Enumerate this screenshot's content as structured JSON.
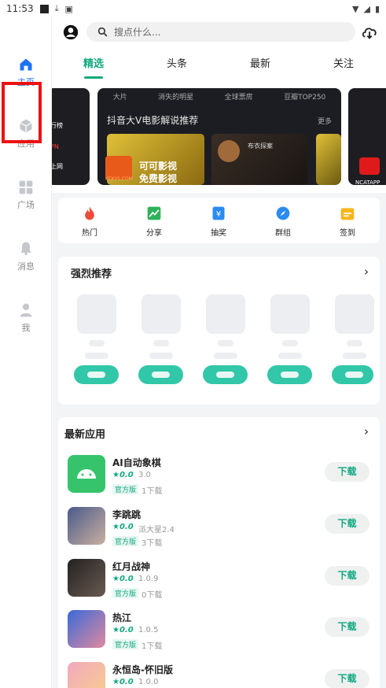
{
  "status_bar": {
    "time": "11:53"
  },
  "sidebar": {
    "items": [
      {
        "label": "主页",
        "icon": "home-icon"
      },
      {
        "label": "应用",
        "icon": "apps-cube-icon"
      },
      {
        "label": "广场",
        "icon": "grid-icon"
      },
      {
        "label": "消息",
        "icon": "bell-icon"
      },
      {
        "label": "我",
        "icon": "person-icon"
      }
    ]
  },
  "search": {
    "placeholder": "搜点什么..."
  },
  "tabs": [
    "精选",
    "头条",
    "最新",
    "关注"
  ],
  "banner": {
    "links": [
      "大片",
      "消失的明星",
      "全球票房",
      "豆瓣TOP250"
    ],
    "title": "抖音大V电影解说推荐",
    "more": "更多",
    "poster_brand": "KEKYS.COM",
    "poster_line1": "可可影视",
    "poster_line2": "免费影视",
    "side_right_label": "NCATAPP",
    "side_left_labels": [
      "行榜",
      "PN",
      "上网"
    ],
    "poster2_title": "布衣探案"
  },
  "quick_links": [
    {
      "label": "热门",
      "icon": "flame-icon",
      "color": "#ef4b3a"
    },
    {
      "label": "分享",
      "icon": "chart-share-icon",
      "color": "#2fb25a"
    },
    {
      "label": "抽奖",
      "icon": "lottery-yen-icon",
      "color": "#2a8bf2"
    },
    {
      "label": "群组",
      "icon": "compass-icon",
      "color": "#2a8bf2"
    },
    {
      "label": "签到",
      "icon": "calendar-icon",
      "color": "#f5b61c"
    }
  ],
  "recommended": {
    "title": "强烈推荐"
  },
  "latest": {
    "title": "最新应用",
    "apps": [
      {
        "name": "AI自动象棋",
        "rating": "0.0",
        "version": "3.0",
        "tag": "官方版",
        "downloads": "1下载",
        "button": "下载"
      },
      {
        "name": "李跳跳",
        "rating": "0.0",
        "version": "派大星2.4",
        "tag": "官方版",
        "downloads": "3下载",
        "button": "下载"
      },
      {
        "name": "红月战神",
        "rating": "0.0",
        "version": "1.0.9",
        "tag": "官方版",
        "downloads": "0下载",
        "button": "下载"
      },
      {
        "name": "热江",
        "rating": "0.0",
        "version": "1.0.5",
        "tag": "官方版",
        "downloads": "1下载",
        "button": "下载"
      },
      {
        "name": "永恒岛-怀旧版",
        "rating": "0.0",
        "version": "1.0.0",
        "tag": "官方版",
        "downloads": "",
        "button": "下载"
      }
    ]
  },
  "colors": {
    "accent": "#12a97f",
    "nav_active": "#1d74f5",
    "highlight": "#e11111"
  }
}
